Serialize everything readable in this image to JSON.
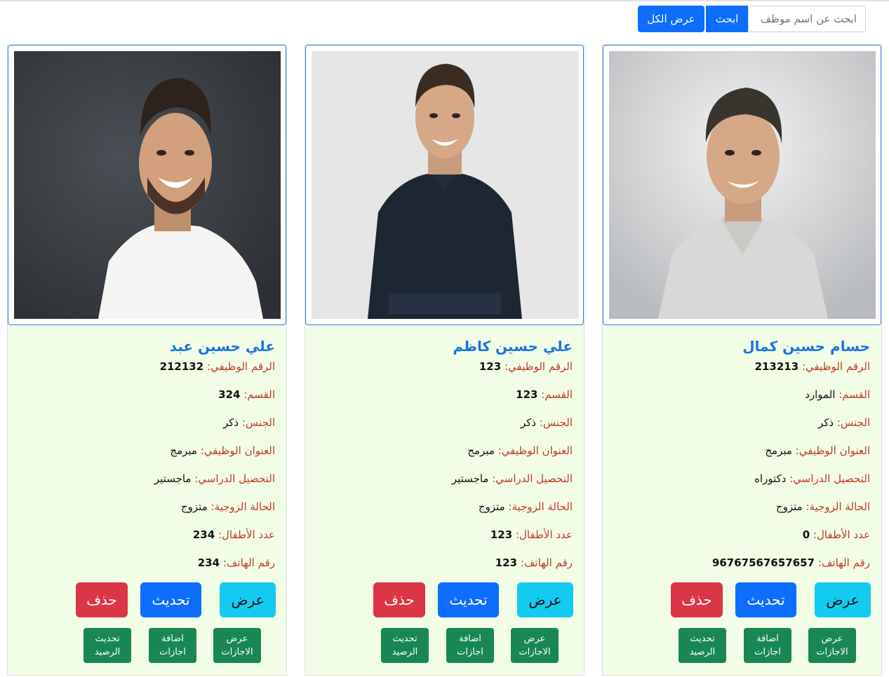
{
  "search": {
    "placeholder": "ابحث عن اسم موظف",
    "search_label": "ابحث",
    "show_all_label": "عرض الكل"
  },
  "labels": {
    "id": "الرقم الوظيفي:",
    "dept": "القسم:",
    "gender": "الجنس:",
    "title": "العنوان الوظيفي:",
    "education": "التحصيل الدراسي:",
    "marital": "الحالة الزوجية:",
    "children": "عدد الأطفال:",
    "phone": "رقم الهاتف:"
  },
  "actions": {
    "view": "عرض",
    "update": "تحديث",
    "delete": "حذف",
    "view_leaves": "عرض\nالاجازات",
    "add_leaves": "اضافة\nاجازات",
    "update_balance": "تحديث\nالرصيد"
  },
  "employees": [
    {
      "name": "حسام حسين كمال",
      "id": "213213",
      "dept": "الموارد",
      "gender": "ذكر",
      "title": "مبرمج",
      "education": "دكتوراه",
      "marital": "متزوج",
      "children": "0",
      "phone": "96767567657657"
    },
    {
      "name": "علي حسين كاظم",
      "id": "123",
      "dept": "123",
      "gender": "ذكر",
      "title": "مبرمج",
      "education": "ماجستير",
      "marital": "متزوج",
      "children": "123",
      "phone": "123"
    },
    {
      "name": "علي حسين عبد",
      "id": "212132",
      "dept": "324",
      "gender": "ذكر",
      "title": "مبرمج",
      "education": "ماجستير",
      "marital": "متزوج",
      "children": "234",
      "phone": "234"
    }
  ]
}
